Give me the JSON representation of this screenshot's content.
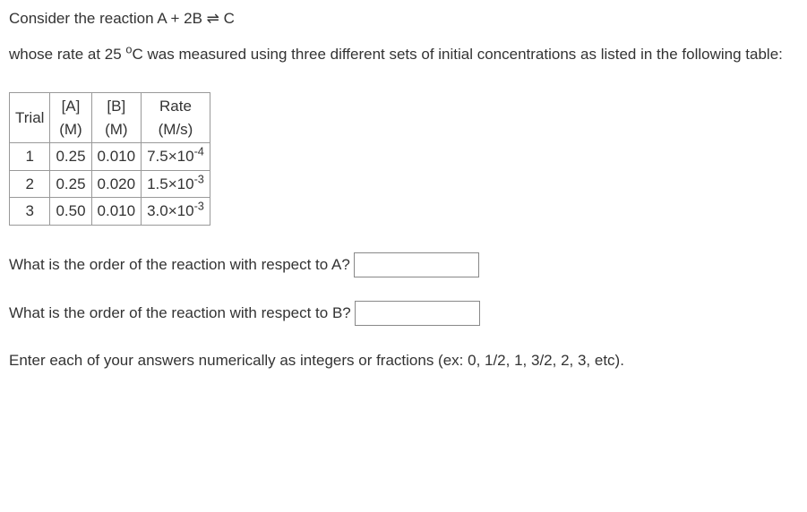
{
  "intro": {
    "line1_pre": "Consider the reaction A + 2B ",
    "line1_sym": "⇌",
    "line1_post": " C",
    "line2_pre": "whose rate at 25 ",
    "line2_deg": "o",
    "line2_post": "C was measured using three different sets of initial concentrations as listed in the following table:"
  },
  "table": {
    "headers": {
      "trial": "Trial",
      "a_top": "[A]",
      "a_unit": "(M)",
      "b_top": "[B]",
      "b_unit": "(M)",
      "rate_top": "Rate",
      "rate_unit": "(M/s)"
    },
    "rows": [
      {
        "trial": "1",
        "a": "0.25",
        "b": "0.010",
        "rate_coef": "7.5×10",
        "rate_exp": "-4"
      },
      {
        "trial": "2",
        "a": "0.25",
        "b": "0.020",
        "rate_coef": "1.5×10",
        "rate_exp": "-3"
      },
      {
        "trial": "3",
        "a": "0.50",
        "b": "0.010",
        "rate_coef": "3.0×10",
        "rate_exp": "-3"
      }
    ]
  },
  "questions": {
    "qA": "What is the order of the reaction with respect to A?",
    "qB": "What is the order of the reaction with respect to B?",
    "instructions": "Enter each of your answers numerically as integers or fractions (ex: 0, 1/2, 1, 3/2, 2, 3, etc)."
  }
}
